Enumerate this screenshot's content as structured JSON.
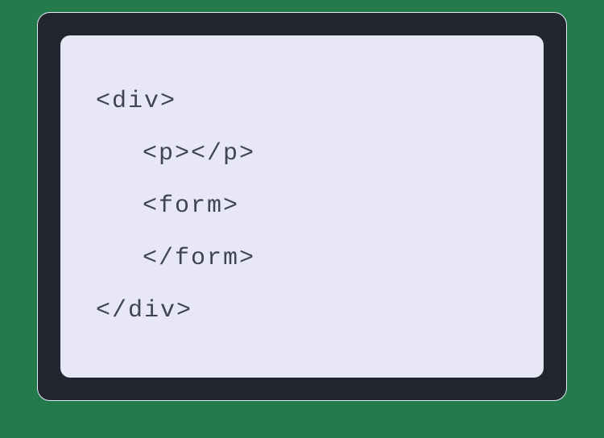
{
  "code": {
    "line1": "<div>",
    "line2": "<p></p>",
    "line3": "<form>",
    "line4": "</form>",
    "line5": "</div>"
  }
}
